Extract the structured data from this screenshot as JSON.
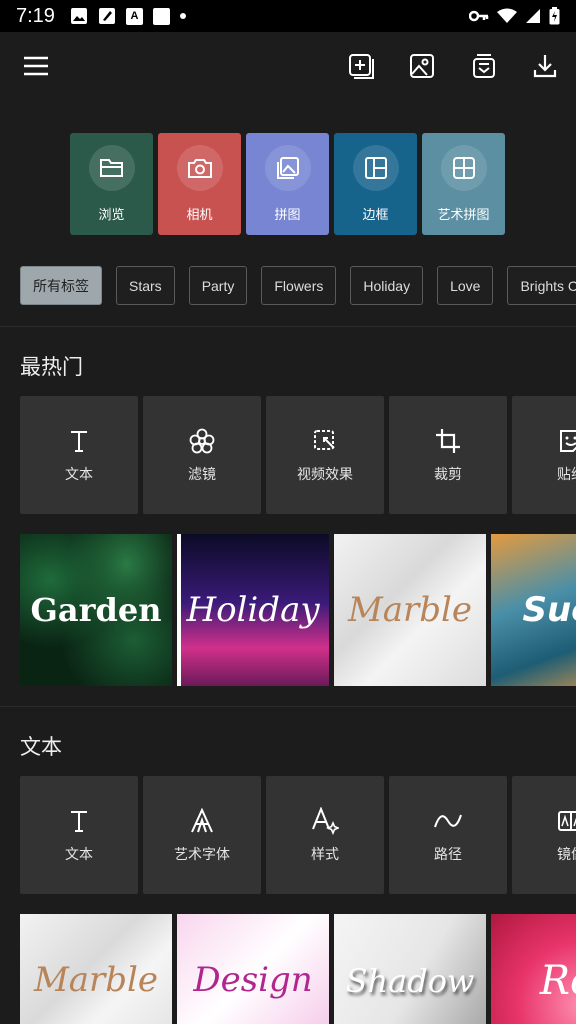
{
  "status_bar": {
    "time": "7:19",
    "letter_icon": "A"
  },
  "toolbar": {
    "menu": "menu-icon",
    "actions": [
      "add-page-icon",
      "image-icon",
      "template-icon",
      "download-icon"
    ]
  },
  "categories": [
    {
      "label": "浏览",
      "color": "#2b5a4b",
      "icon": "folder-icon"
    },
    {
      "label": "相机",
      "color": "#c85250",
      "icon": "camera-icon"
    },
    {
      "label": "拼图",
      "color": "#7785d3",
      "icon": "collage-icon"
    },
    {
      "label": "边框",
      "color": "#16638c",
      "icon": "border-icon"
    },
    {
      "label": "艺术拼图",
      "color": "#5b8fa1",
      "icon": "art-collage-icon"
    }
  ],
  "tags": [
    "所有标签",
    "Stars",
    "Party",
    "Flowers",
    "Holiday",
    "Love",
    "Brights Co"
  ],
  "sections": [
    {
      "title": "最热门",
      "tools": [
        {
          "label": "文本",
          "icon": "text-icon"
        },
        {
          "label": "滤镜",
          "icon": "filter-icon"
        },
        {
          "label": "视频效果",
          "icon": "video-effect-icon"
        },
        {
          "label": "裁剪",
          "icon": "crop-icon"
        },
        {
          "label": "贴纸",
          "icon": "sticker-icon"
        }
      ],
      "thumbs": [
        "Garden",
        "Holiday",
        "Marble",
        "Succ"
      ]
    },
    {
      "title": "文本",
      "tools": [
        {
          "label": "文本",
          "icon": "text-icon"
        },
        {
          "label": "艺术字体",
          "icon": "art-font-icon"
        },
        {
          "label": "样式",
          "icon": "style-icon"
        },
        {
          "label": "路径",
          "icon": "path-icon"
        },
        {
          "label": "镜像",
          "icon": "mirror-icon"
        }
      ],
      "thumbs": [
        "Marble",
        "Design",
        "Shadow",
        "Ro"
      ]
    }
  ]
}
